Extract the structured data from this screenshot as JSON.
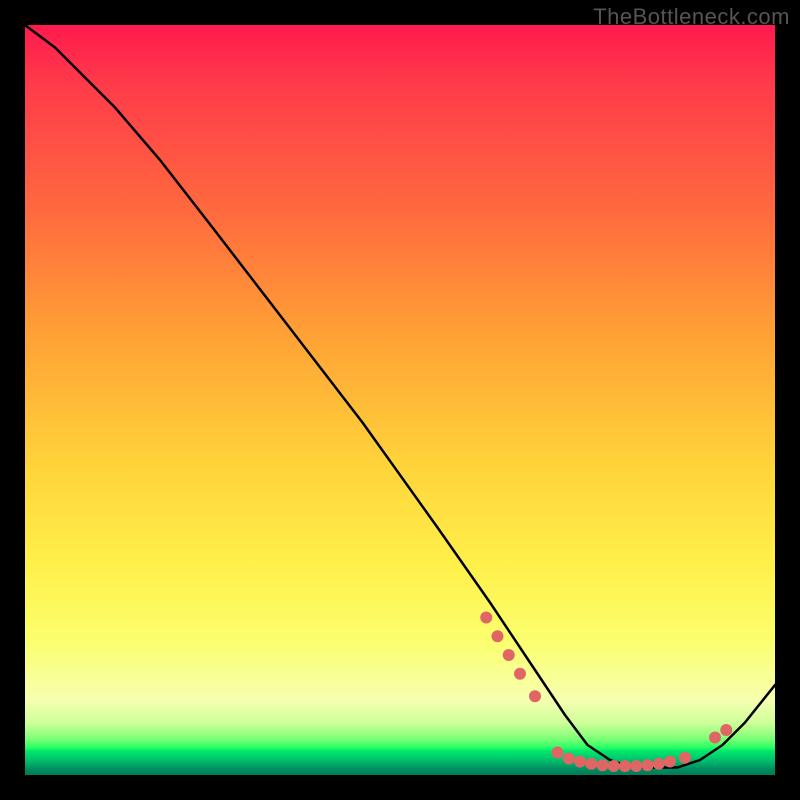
{
  "watermark": "TheBottleneck.com",
  "chart_data": {
    "type": "line",
    "title": "",
    "xlabel": "",
    "ylabel": "",
    "xlim": [
      0,
      100
    ],
    "ylim": [
      0,
      100
    ],
    "grid": false,
    "legend": false,
    "series": [
      {
        "name": "curve",
        "color": "#000000",
        "x": [
          0,
          4,
          8,
          12,
          18,
          25,
          35,
          45,
          55,
          62,
          68,
          72,
          75,
          78,
          81,
          84,
          87,
          90,
          93,
          96,
          100
        ],
        "y": [
          100,
          97,
          93,
          89,
          82,
          73,
          60,
          47,
          33,
          23,
          14,
          8,
          4,
          2,
          1,
          1,
          1,
          2,
          4,
          7,
          12
        ]
      }
    ],
    "markers": {
      "name": "dots",
      "color": "#e06666",
      "radius_px": 6,
      "points": [
        {
          "x": 61.5,
          "y": 21.0
        },
        {
          "x": 63.0,
          "y": 18.5
        },
        {
          "x": 64.5,
          "y": 16.0
        },
        {
          "x": 66.0,
          "y": 13.5
        },
        {
          "x": 68.0,
          "y": 10.5
        },
        {
          "x": 71.0,
          "y": 3.0
        },
        {
          "x": 72.5,
          "y": 2.2
        },
        {
          "x": 74.0,
          "y": 1.8
        },
        {
          "x": 75.5,
          "y": 1.5
        },
        {
          "x": 77.0,
          "y": 1.3
        },
        {
          "x": 78.5,
          "y": 1.2
        },
        {
          "x": 80.0,
          "y": 1.2
        },
        {
          "x": 81.5,
          "y": 1.2
        },
        {
          "x": 83.0,
          "y": 1.3
        },
        {
          "x": 84.5,
          "y": 1.5
        },
        {
          "x": 86.0,
          "y": 1.8
        },
        {
          "x": 88.0,
          "y": 2.3
        },
        {
          "x": 92.0,
          "y": 5.0
        },
        {
          "x": 93.5,
          "y": 6.0
        }
      ]
    },
    "background_gradient": {
      "direction": "vertical",
      "stops": [
        {
          "pos": 0.0,
          "color": "#ff1a4d"
        },
        {
          "pos": 0.25,
          "color": "#ff6a3e"
        },
        {
          "pos": 0.58,
          "color": "#ffd23a"
        },
        {
          "pos": 0.82,
          "color": "#fbff6d"
        },
        {
          "pos": 0.96,
          "color": "#2bff66"
        },
        {
          "pos": 1.0,
          "color": "#007a57"
        }
      ]
    }
  }
}
